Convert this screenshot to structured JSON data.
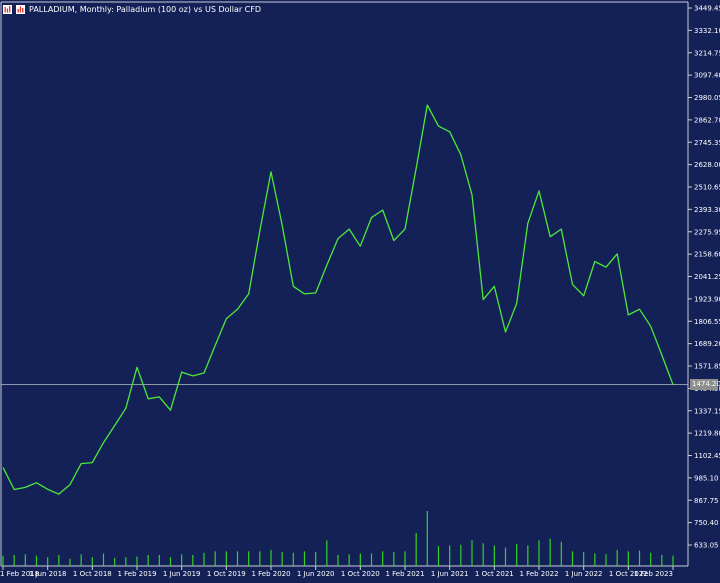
{
  "window": {
    "symbol": "PALLADIUM",
    "title": "PALLADIUM, Monthly:  Palladium (100 oz) vs US Dollar CFD",
    "icon": "chart-bars-icon"
  },
  "current_price": "1474.20",
  "colors": {
    "background": "#142157",
    "line": "#4be83a",
    "volume": "#33d129",
    "axis": "#c9cdd9",
    "text": "#ffffff",
    "price_line": "#b7bdc8"
  },
  "chart_data": {
    "type": "line",
    "title": "PALLADIUM, Monthly:  Palladium (100 oz) vs US Dollar CFD",
    "y_ticks": [
      "3449.45",
      "3332.10",
      "3214.75",
      "3097.40",
      "2980.05",
      "2862.70",
      "2745.35",
      "2628.00",
      "2510.65",
      "2393.30",
      "2275.95",
      "2158.60",
      "2041.25",
      "1923.90",
      "1806.55",
      "1689.20",
      "1571.85",
      "1454.50",
      "1337.15",
      "1219.80",
      "1102.45",
      "985.10",
      "867.75",
      "750.40",
      "633.05"
    ],
    "x_ticks": [
      "1 Feb 2018",
      "1 Jun 2018",
      "1 Oct 2018",
      "1 Feb 2019",
      "1 Jun 2019",
      "1 Oct 2019",
      "1 Feb 2020",
      "1 Jun 2020",
      "1 Oct 2020",
      "1 Feb 2021",
      "1 Jun 2021",
      "1 Oct 2021",
      "1 Feb 2022",
      "1 Jun 2022",
      "1 Oct 2022",
      "1 Feb 2023"
    ],
    "ylim": [
      633.05,
      3449.45
    ],
    "grid": false,
    "series": [
      {
        "values": [
          1040,
          924,
          935,
          960,
          925,
          900,
          950,
          1060,
          1065,
          1170,
          1260,
          1350,
          1565,
          1400,
          1410,
          1340,
          1540,
          1520,
          1535,
          1680,
          1820,
          1870,
          1950,
          2280,
          2590,
          2310,
          1990,
          1950,
          1955,
          2100,
          2240,
          2290,
          2200,
          2350,
          2390,
          2230,
          2290,
          2610,
          2940,
          2830,
          2800,
          2680,
          2470,
          1920,
          1990,
          1750,
          1900,
          2320,
          2490,
          2250,
          2290,
          2000,
          1940,
          2120,
          2090,
          2160,
          1840,
          1870,
          1780,
          1630,
          1474.2
        ]
      }
    ],
    "volume_bars": [
      2,
      1,
      1,
      1,
      0,
      1,
      0,
      1,
      0,
      1,
      0,
      0,
      2,
      1,
      1,
      1,
      0,
      1,
      2,
      3,
      3,
      3,
      3,
      3,
      3,
      3,
      3,
      3,
      3,
      3,
      1,
      3,
      0,
      4,
      2,
      3,
      1,
      3,
      1,
      3,
      3,
      3,
      3,
      3,
      2,
      3,
      3,
      0,
      3,
      4,
      3,
      2,
      3,
      3,
      2,
      4,
      4,
      4,
      3,
      2,
      2
    ],
    "volume": [
      28,
      30,
      32,
      28,
      24,
      30,
      20,
      32,
      24,
      34,
      22,
      24,
      26,
      30,
      30,
      24,
      32,
      30,
      36,
      40,
      40,
      40,
      40,
      40,
      44,
      38,
      36,
      40,
      38,
      70,
      30,
      32,
      34,
      34,
      40,
      38,
      40,
      90,
      150,
      54,
      56,
      58,
      70,
      62,
      56,
      50,
      60,
      56,
      70,
      74,
      66,
      40,
      38,
      34,
      32,
      44,
      40,
      42,
      36,
      30,
      28
    ]
  }
}
